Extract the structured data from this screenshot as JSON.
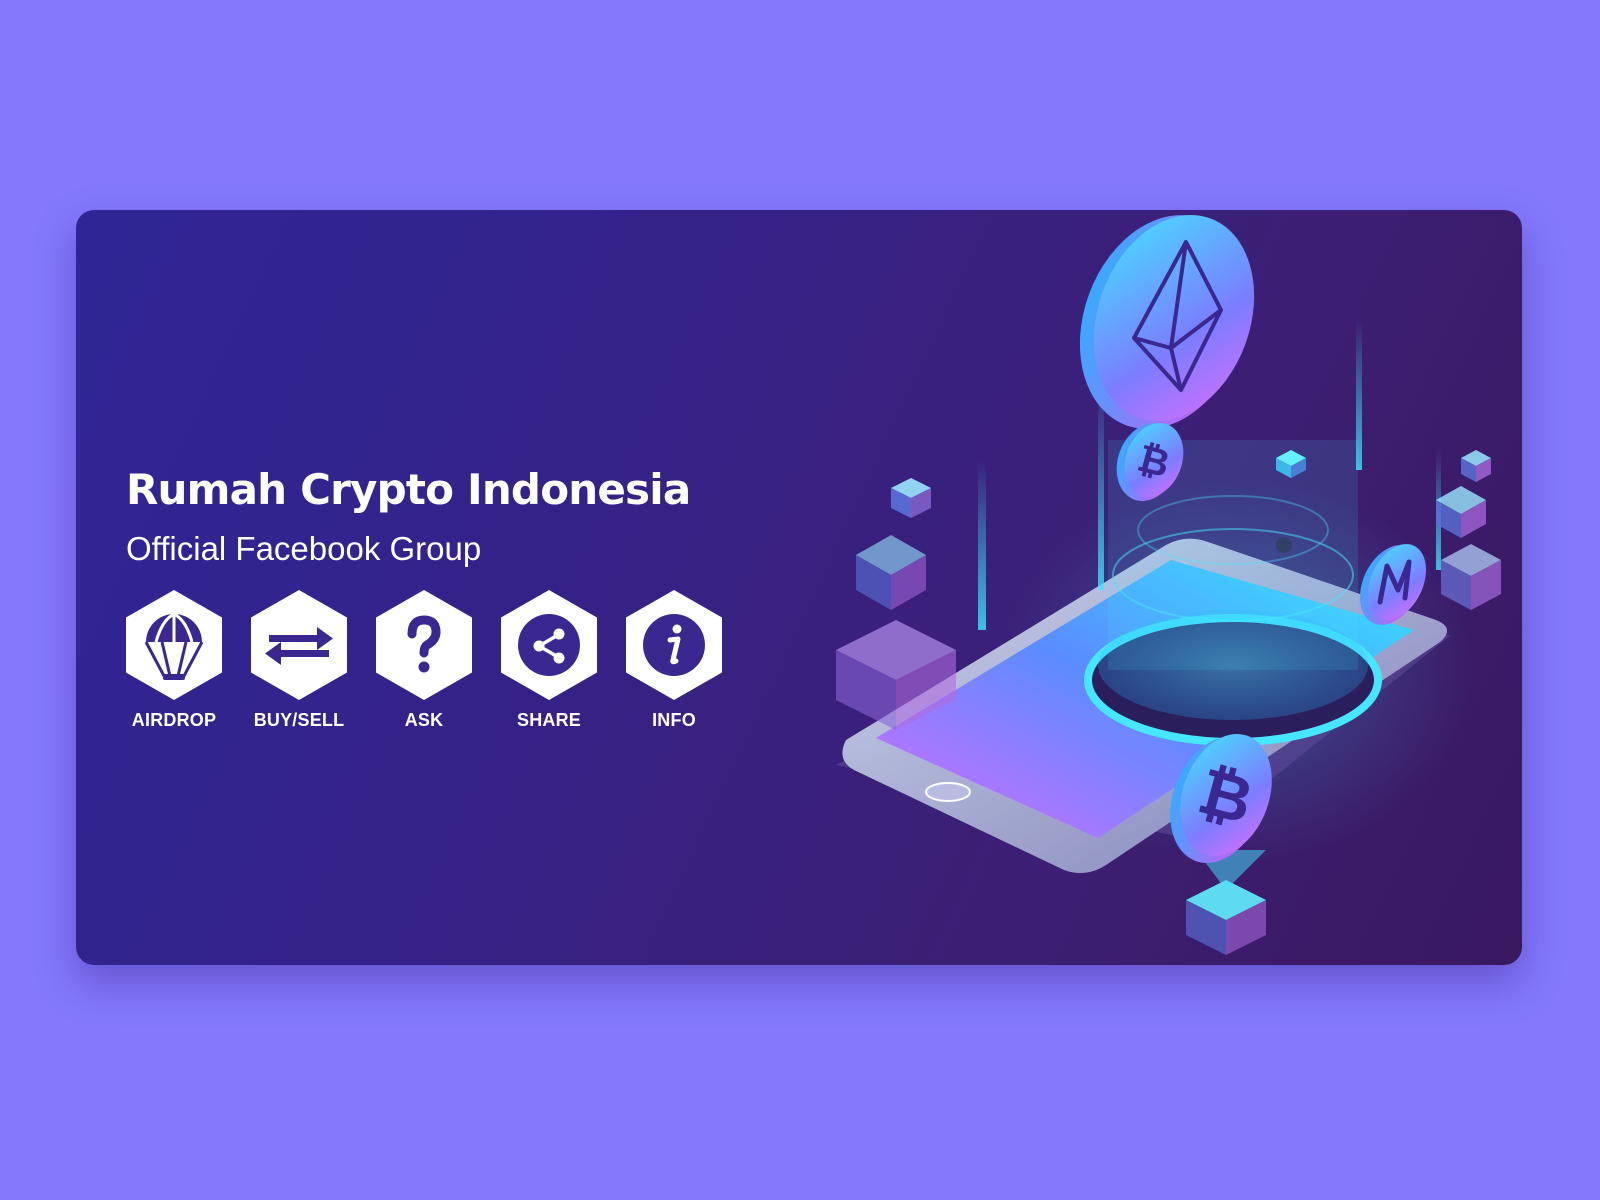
{
  "banner": {
    "title": "Rumah Crypto Indonesia",
    "subtitle": "Official Facebook Group"
  },
  "actions": [
    {
      "label": "AIRDROP",
      "icon": "parachute-icon"
    },
    {
      "label": "BUY/SELL",
      "icon": "exchange-arrows-icon"
    },
    {
      "label": "ASK",
      "icon": "question-mark-icon"
    },
    {
      "label": "SHARE",
      "icon": "share-icon"
    },
    {
      "label": "INFO",
      "icon": "info-icon"
    }
  ],
  "illustration": {
    "icons": [
      "ethereum-coin-icon",
      "bitcoin-coin-icon",
      "monero-coin-icon",
      "smartphone-icon",
      "cube-icon"
    ]
  },
  "colors": {
    "page_background": "#8479fd",
    "banner_start": "#2e2696",
    "banner_end": "#3a1860",
    "hex_fill": "#ffffff",
    "glyph": "#3a2890",
    "cyan_accent": "#3fe6ff",
    "magenta_accent": "#d770ff"
  }
}
